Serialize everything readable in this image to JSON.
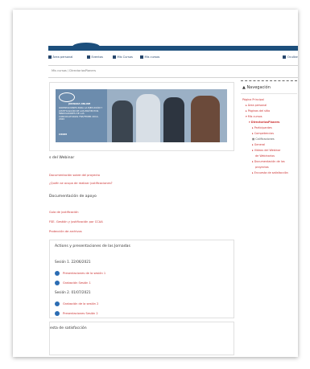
{
  "menu": {
    "items": [
      {
        "label": "Área personal",
        "icon": "home-icon"
      },
      {
        "label": "Eventos",
        "icon": "calendar-icon"
      },
      {
        "label": "Mis Cursos",
        "icon": "courses-icon"
      },
      {
        "label": "Mis cursos",
        "icon": "graduation-icon"
      }
    ],
    "right_label": "Ocultar"
  },
  "breadcrumb": "Mis cursos / DirectoriosPlaners",
  "banner": {
    "badge": "UNED",
    "title": "JORNADA ONLINE",
    "text": "ORIENTACIONES PARA LA EJECUCIÓN Y JUSTIFICACIÓN DE LOS PROYECTOS INNOVADORES DE LAS CONVOCATORIAS FSE/FEDER 2014-2020",
    "logo": "CRDM",
    "colors": {
      "bg": "#6c8cad",
      "text": "#ffffff"
    }
  },
  "sections": {
    "webinar": {
      "title": "s del Webinar",
      "links": [
        "Documentación sobre del proyecto",
        "¿Quién se ocupa de realizar justificaciones?"
      ]
    },
    "docs": {
      "title": "Documentación de apoyo",
      "links": [
        "Guía de justificación",
        "FSE. Gestión y justificación por CCAA",
        "Protección de archivos"
      ]
    },
    "actions": {
      "title": "Actions y presentaciones de las Jornadas",
      "session1": "Sesión 1. 22/06/2021",
      "session1_links": [
        "Presentaciones de la sesión 1",
        "Grabación Sesión 1"
      ],
      "session2": "Sesión 2. 01/07/2021",
      "session2_links": [
        "Grabación de la sesión 2",
        "Presentaciones Sesión 2"
      ]
    },
    "survey": {
      "title": "esta de satisfacción"
    }
  },
  "nav": {
    "title": "Navegación",
    "items": [
      {
        "label": "Página Principal",
        "level": 0,
        "dark": false
      },
      {
        "label": "Área personal",
        "level": 1,
        "dark": false
      },
      {
        "label": "Páginas del sitio",
        "level": 1,
        "dark": false
      },
      {
        "label": "Mis cursos",
        "level": 1,
        "dark": false
      },
      {
        "label": "DirectoriosPlaners",
        "level": 2,
        "dark": false
      },
      {
        "label": "Participantes",
        "level": 3,
        "dark": false
      },
      {
        "label": "Competencias",
        "level": 3,
        "dark": false
      },
      {
        "label": "Calificaciones",
        "level": 3,
        "dark": true
      },
      {
        "label": "General",
        "level": 3,
        "dark": false
      },
      {
        "label": "Vídeos del Webinar",
        "level": 3,
        "dark": false
      },
      {
        "label": "de Webinarios",
        "level": 3,
        "dark": false
      },
      {
        "label": "Documentación de los",
        "level": 3,
        "dark": false
      },
      {
        "label": "proyectos",
        "level": 3,
        "dark": false
      },
      {
        "label": "Encuesta de satisfacción",
        "level": 3,
        "dark": false
      }
    ]
  },
  "colors": {
    "accent": "#1c4f7c",
    "link": "#cc3333",
    "dot": "#2b6cb3"
  }
}
